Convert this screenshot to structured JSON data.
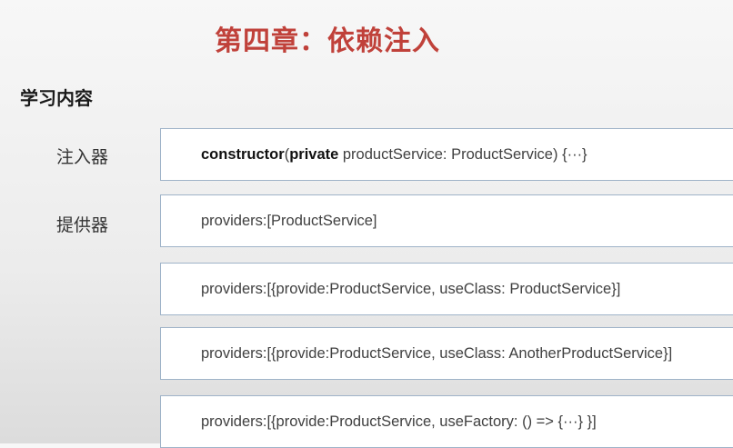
{
  "slide": {
    "title": "第四章：依赖注入",
    "section_heading": "学习内容"
  },
  "labels": {
    "injector": "注入器",
    "provider": "提供器"
  },
  "code": {
    "constructor": {
      "kw1": "constructor",
      "paren": "(",
      "kw2": "private",
      "rest": " productService: ProductService) {···}"
    },
    "providers_1": "providers:[ProductService]",
    "providers_2": "providers:[{provide:ProductService, useClass: ProductService}]",
    "providers_3": "providers:[{provide:ProductService, useClass: AnotherProductService}]",
    "providers_4": "providers:[{provide:ProductService, useFactory: () => {···} }]"
  }
}
